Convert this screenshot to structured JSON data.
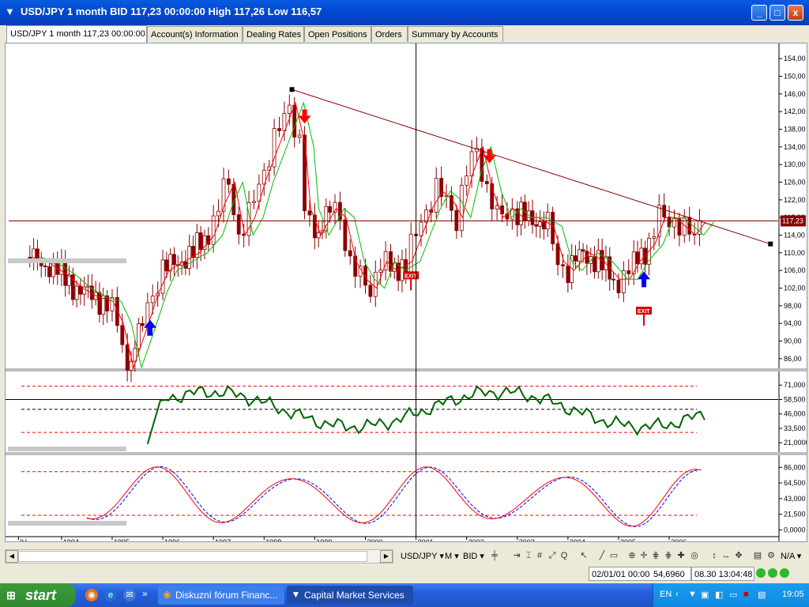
{
  "window": {
    "title": "USD/JPY 1 month BID 117,23 00:00:00 High 117,26 Low 116,57",
    "buttons": [
      "_",
      "□",
      "x"
    ]
  },
  "tabs": [
    {
      "label": "USD/JPY 1 month 117,23 00:00:00",
      "active": true
    },
    {
      "label": "Account(s) Information"
    },
    {
      "label": "Dealing Rates"
    },
    {
      "label": "Open Positions"
    },
    {
      "label": "Orders"
    },
    {
      "label": "Summary by Accounts"
    }
  ],
  "chart_data": [
    {
      "type": "candlestick",
      "title": "",
      "x_labels": [
        "IV",
        "1994",
        "1995",
        "1996",
        "1997",
        "1998",
        "1999",
        "2000",
        "2001",
        "2002",
        "2003",
        "2004",
        "2005",
        "2006"
      ],
      "y_ticks": [
        "154,00",
        "150,00",
        "146,00",
        "142,00",
        "138,00",
        "134,00",
        "130,00",
        "126,00",
        "122,00",
        "118,00",
        "114,00",
        "110,00",
        "106,00",
        "102,00",
        "98,00",
        "94,00",
        "90,00",
        "86,00"
      ],
      "ylim": [
        84,
        156
      ],
      "current_price": "117,23",
      "close_path": [
        [
          1993.3,
          109
        ],
        [
          1993.6,
          108
        ],
        [
          1994.0,
          105
        ],
        [
          1994.3,
          102
        ],
        [
          1994.6,
          100
        ],
        [
          1994.9,
          99
        ],
        [
          1995.1,
          94
        ],
        [
          1995.3,
          84
        ],
        [
          1995.6,
          94
        ],
        [
          1995.8,
          101
        ],
        [
          1996.0,
          106
        ],
        [
          1996.3,
          108
        ],
        [
          1996.6,
          110
        ],
        [
          1996.9,
          114
        ],
        [
          1997.1,
          121
        ],
        [
          1997.3,
          126
        ],
        [
          1997.5,
          114
        ],
        [
          1997.7,
          118
        ],
        [
          1997.9,
          126
        ],
        [
          1998.1,
          132
        ],
        [
          1998.3,
          138
        ],
        [
          1998.5,
          144
        ],
        [
          1998.7,
          134
        ],
        [
          1998.8,
          120
        ],
        [
          1999.0,
          114
        ],
        [
          1999.3,
          120
        ],
        [
          1999.5,
          118
        ],
        [
          1999.7,
          108
        ],
        [
          1999.9,
          104
        ],
        [
          2000.1,
          102
        ],
        [
          2000.3,
          108
        ],
        [
          2000.5,
          106
        ],
        [
          2000.8,
          108
        ],
        [
          2001.0,
          114
        ],
        [
          2001.2,
          120
        ],
        [
          2001.4,
          124
        ],
        [
          2001.6,
          122
        ],
        [
          2001.8,
          118
        ],
        [
          2002.0,
          128
        ],
        [
          2002.2,
          134
        ],
        [
          2002.4,
          124
        ],
        [
          2002.6,
          118
        ],
        [
          2002.8,
          120
        ],
        [
          2003.0,
          118
        ],
        [
          2003.3,
          118
        ],
        [
          2003.6,
          116
        ],
        [
          2003.8,
          108
        ],
        [
          2004.0,
          106
        ],
        [
          2004.3,
          110
        ],
        [
          2004.6,
          108
        ],
        [
          2004.9,
          104
        ],
        [
          2005.1,
          104
        ],
        [
          2005.3,
          108
        ],
        [
          2005.6,
          112
        ],
        [
          2005.8,
          118
        ],
        [
          2006.0,
          118
        ],
        [
          2006.2,
          116
        ],
        [
          2006.4,
          114
        ],
        [
          2006.6,
          117
        ]
      ],
      "trendline": {
        "from": [
          1998.55,
          147
        ],
        "to": [
          2008.0,
          112
        ]
      },
      "markers": [
        {
          "type": "down-arrow",
          "x": 1998.8,
          "y": 140,
          "color": "#ff0000"
        },
        {
          "type": "down-arrow",
          "x": 2002.45,
          "y": 131,
          "color": "#ff0000"
        },
        {
          "type": "up-arrow",
          "x": 1995.75,
          "y": 93,
          "color": "#0000ff"
        },
        {
          "type": "up-arrow",
          "x": 2005.5,
          "y": 104,
          "color": "#0000ff"
        },
        {
          "type": "exit",
          "x": 2000.9,
          "y": 104,
          "label": "EXIT"
        },
        {
          "type": "exit",
          "x": 2005.5,
          "y": 96,
          "label": "EXIT"
        }
      ]
    },
    {
      "type": "line",
      "y_ticks": [
        "71,000",
        "58,500",
        "46,000",
        "33,500",
        "21,0000"
      ],
      "current_value": "58,500",
      "levels": [
        70,
        30
      ],
      "ylim": [
        15,
        78
      ]
    },
    {
      "type": "line",
      "y_ticks": [
        "86,000",
        "64,500",
        "43,000",
        "21,500",
        "0,0000"
      ],
      "levels": [
        80,
        20
      ],
      "ylim": [
        -5,
        95
      ]
    }
  ],
  "toolbar": {
    "symbol": "USD/JPY",
    "period": "M",
    "price_type": "BID",
    "right_value": "N/A"
  },
  "status": {
    "date": "02/01/01 00:00",
    "value": "54,6960",
    "time": "08.30 13:04:48"
  },
  "taskbar": {
    "start_label": "start",
    "tasks": [
      {
        "label": "Diskuzní fórum Financ..."
      },
      {
        "label": "Capital Market Services"
      }
    ],
    "lang": "EN",
    "clock": "19:05"
  },
  "colors": {
    "candle_up": "#8b0000",
    "candle_down": "#8b0000",
    "ma_red": "#ff0000",
    "ma_green": "#00c000",
    "trendline": "#8b0000",
    "rsi": "#006400",
    "stoch_k": "#ff0000",
    "stoch_d": "#0000ff"
  }
}
